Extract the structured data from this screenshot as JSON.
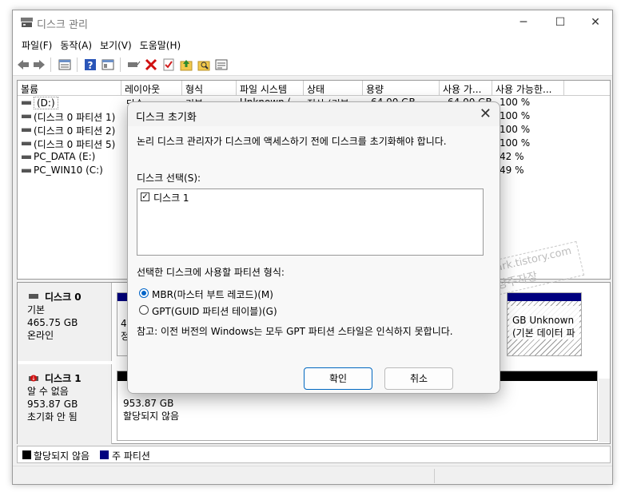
{
  "window": {
    "title": "디스크 관리",
    "minimize": "─",
    "maximize": "☐",
    "close": "✕"
  },
  "menu": [
    "파일(F)",
    "동작(A)",
    "보기(V)",
    "도움말(H)"
  ],
  "toolbar_icons": [
    "back-arrow-icon",
    "forward-arrow-icon",
    "volume-list-icon",
    "help-icon",
    "properties-icon",
    "connect-icon",
    "delete-icon",
    "check-icon",
    "up-folder-icon",
    "search-folder-icon",
    "list-view-icon"
  ],
  "volume_columns": [
    "볼륨",
    "레이아웃",
    "형식",
    "파일 시스템",
    "상태",
    "용량",
    "사용 가...",
    "사용 가능한..."
  ],
  "volumes": [
    {
      "name": "(D:)",
      "layout": "단순",
      "type": "기본",
      "fs": "Unknown (",
      "status": "정상 (기본",
      "capacity": "64.00 GB",
      "free": "64.00 GB",
      "pct": "100 %"
    },
    {
      "name": "(디스크 0 파티션 1)",
      "pct": "100 %"
    },
    {
      "name": "(디스크 0 파티션 2)",
      "pct": "100 %"
    },
    {
      "name": "(디스크 0 파티션 5)",
      "pct": "100 %"
    },
    {
      "name": "PC_DATA (E:)",
      "pct": "42 %"
    },
    {
      "name": "PC_WIN10 (C:)",
      "pct": "49 %"
    }
  ],
  "disks": [
    {
      "name": "디스크 0",
      "type": "기본",
      "size": "465.75 GB",
      "state": "온라인",
      "part_size_partial": "49",
      "part_status_partial": "정",
      "right_part_size": "GB Unknown",
      "right_part_status": "(기본 데이터 파"
    },
    {
      "name": "디스크 1",
      "type": "알 수 없음",
      "size": "953.87 GB",
      "state": "초기화 안 됨",
      "part_size": "953.87 GB",
      "part_status": "할당되지 않음"
    }
  ],
  "legend": [
    {
      "label": "할당되지 않음",
      "color": "#000000"
    },
    {
      "label": "주 파티션",
      "color": "#00007f"
    }
  ],
  "dialog": {
    "title": "디스크 초기화",
    "close": "✕",
    "description": "논리 디스크 관리자가 디스크에 액세스하기 전에 디스크를 초기화해야 합니다.",
    "select_label": "디스크 선택(S):",
    "disk_item": "디스크 1",
    "partition_label": "선택한 디스크에 사용할 파티션 형식:",
    "mbr_option": "MBR(마스터 부트 레코드)(M)",
    "gpt_option": "GPT(GUID 파티션 테이블)(G)",
    "note": "참고: 이전 버전의 Windows는 모두 GPT 파티션 스타일은 인식하지 못합니다.",
    "ok_label": "확인",
    "cancel_label": "취소",
    "accent": "#0067c0"
  },
  "watermark": {
    "line1": "daypark.tistory.com",
    "line2": "똥손 공대생의 일상 BLOG - 일상주자장"
  }
}
